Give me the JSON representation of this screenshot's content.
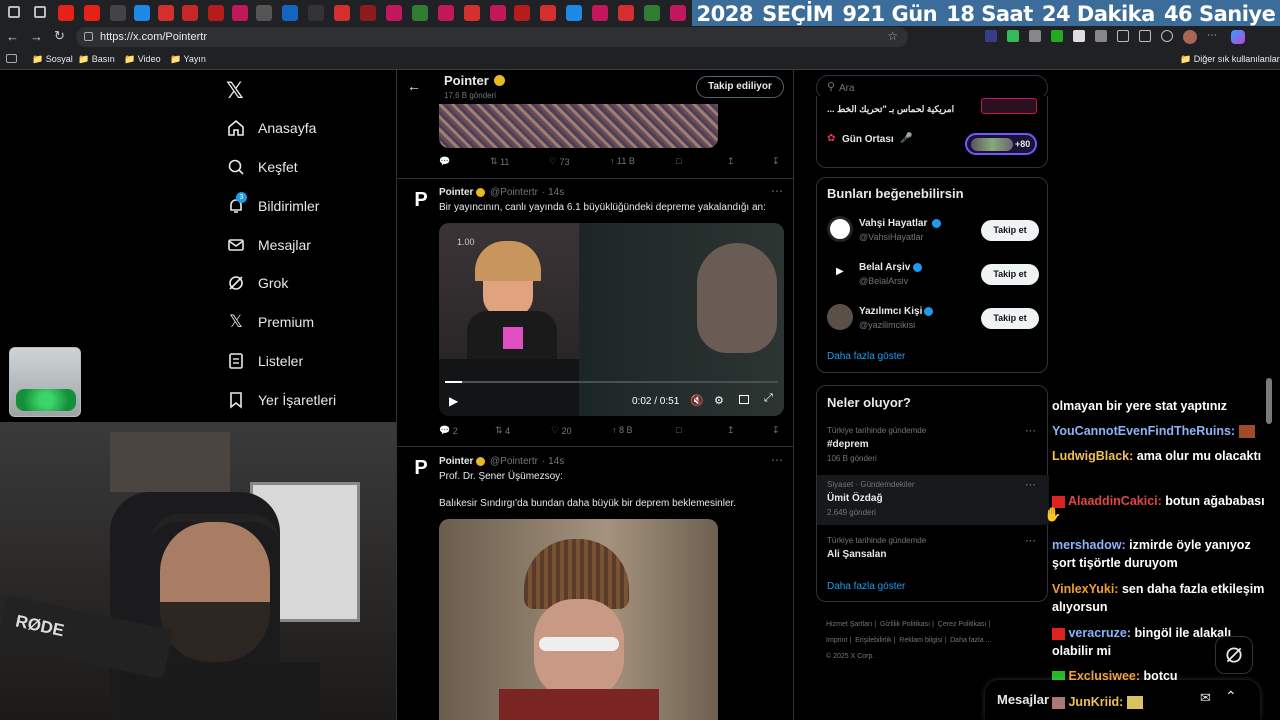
{
  "countdown": {
    "year": "2028",
    "label": "SEÇİM",
    "days": "921 Gün",
    "hours": "18 Saat",
    "minutes": "24 Dakika",
    "seconds": "46 Saniye"
  },
  "browser": {
    "url": "https://x.com/Pointertr",
    "bookmarks": [
      "Sosyal",
      "Basın",
      "Video",
      "Yayın"
    ],
    "other_bookmarks": "Diğer sık kullanılanlar"
  },
  "nav": {
    "items": [
      "Anasayfa",
      "Keşfet",
      "Bildirimler",
      "Mesajlar",
      "Grok",
      "Premium",
      "Listeler",
      "Yer İşaretleri"
    ],
    "notification_count": "3"
  },
  "profile_header": {
    "name": "Pointer",
    "subtitle": "17,6 B gönderi",
    "follow_state": "Takip ediliyor"
  },
  "tweet0_actions": {
    "replies": "",
    "retweets": "11",
    "likes": "73",
    "views": "11 B"
  },
  "tweet1": {
    "name": "Pointer",
    "handle": "@Pointertr",
    "time": "· 14s",
    "text": "Bir yayıncının, canlı yayında 6.1 büyüklüğündeki depreme yakalandığı an:",
    "video_time": "0:02 / 0:51",
    "replies": "2",
    "retweets": "4",
    "likes": "20",
    "views": "8 B"
  },
  "tweet2": {
    "name": "Pointer",
    "handle": "@Pointertr",
    "time": "· 14s",
    "line1": "Prof. Dr. Şener Üşümezsoy:",
    "line2": "Balıkesir Sındırgı'da bundan daha büyük bir deprem beklemesinler."
  },
  "search": {
    "placeholder": "Ara"
  },
  "trending_top": {
    "arabic": "... امريكية لحماس بـ \"تحريك الخط",
    "space": "Gün Ortası",
    "space_count": "+80"
  },
  "suggest": {
    "title": "Bunları beğenebilirsin",
    "users": [
      {
        "name": "Vahşi Hayatlar",
        "handle": "@VahsiHayatlar",
        "button": "Takip et"
      },
      {
        "name": "Belal Arşiv",
        "handle": "@BelalArsiv",
        "button": "Takip et"
      },
      {
        "name": "Yazılımcı Kişi",
        "handle": "@yazilimcikisi",
        "button": "Takip et"
      }
    ],
    "more": "Daha fazla göster"
  },
  "trends": {
    "title": "Neler oluyor?",
    "items": [
      {
        "context": "Türkiye tarihinde gündemde",
        "topic": "#deprem",
        "count": "106 B gönderi"
      },
      {
        "context": "Siyaset · Gündemdekiler",
        "topic": "Ümit Özdağ",
        "count": "2.649 gönderi"
      },
      {
        "context": "Türkiye tarihinde gündemde",
        "topic": "Ali Şansalan",
        "count": ""
      }
    ],
    "more": "Daha fazla göster"
  },
  "footer": {
    "l1": "Hizmet Şartları",
    "l2": "Gizlilik Politikası",
    "l3": "Çerez Politikası",
    "l4": "Imprint",
    "l5": "Erişilebilirlik",
    "l6": "Reklam bilgisi",
    "l7": "Daha fazla ...",
    "l8": "© 2025 X Corp."
  },
  "chat": [
    {
      "user": "",
      "msg": "olmayan bir yere stat yaptınız",
      "color": "#ffffff"
    },
    {
      "user": "YouCannotEvenFindTheRuins:",
      "msg": "",
      "color": "#8ab4f8"
    },
    {
      "user": "LudwigBlack:",
      "msg": "ama olur mu olacaktı",
      "color": "#f0c050"
    },
    {
      "user": "AlaaddinCakici:",
      "msg": "botun ağababası",
      "color": "#e04646"
    },
    {
      "user": "mershadow:",
      "msg": "izmirde öyle yanıyoz şort tişörtle duruyom",
      "color": "#8ab4f8"
    },
    {
      "user": "VinlexYuki:",
      "msg": "sen daha fazla etkileşim alıyorsun",
      "color": "#f0a030"
    },
    {
      "user": "veracruze:",
      "msg": "bingöl ile alakalı olabilir mi",
      "color": "#8ab4f8"
    },
    {
      "user": "Exclusiwee:",
      "msg": "botçu",
      "color": "#f0a030"
    },
    {
      "user": "JunKriid:",
      "msg": "",
      "color": "#f0c050"
    }
  ],
  "messages_drawer": {
    "label": "Mesajlar"
  },
  "webcam": {
    "mic_brand": "RØDE"
  },
  "colors": {
    "accent": "#1d9bf0",
    "verified": "#1d9bf0",
    "countdown_bg": "#3b6c9a"
  }
}
